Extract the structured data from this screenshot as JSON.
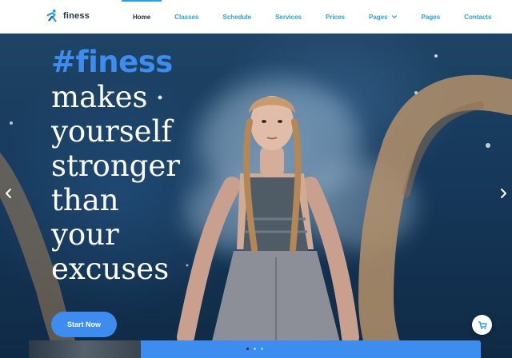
{
  "brand": {
    "name": "finess",
    "icon": "running-figure-icon",
    "color": "#2aa1dd"
  },
  "nav": {
    "items": [
      {
        "label": "Home",
        "active": true,
        "dropdown": false
      },
      {
        "label": "Classes",
        "active": false,
        "dropdown": false
      },
      {
        "label": "Schedule",
        "active": false,
        "dropdown": false
      },
      {
        "label": "Services",
        "active": false,
        "dropdown": false
      },
      {
        "label": "Prices",
        "active": false,
        "dropdown": false
      },
      {
        "label": "Pages",
        "active": false,
        "dropdown": true
      },
      {
        "label": "Pages",
        "active": false,
        "dropdown": false
      },
      {
        "label": "Contacts",
        "active": false,
        "dropdown": false
      }
    ]
  },
  "hero": {
    "hashtag": "#finess",
    "headline_lines": [
      "makes",
      "yourself",
      "stronger",
      "than",
      "your",
      "excuses"
    ],
    "cta_label": "Start Now",
    "prev_icon": "chevron-left-icon",
    "next_icon": "chevron-right-icon"
  },
  "slider": {
    "dot_count": 3,
    "active_dot": 0
  },
  "cart": {
    "icon": "shopping-cart-icon"
  },
  "colors": {
    "accent": "#3d8df0",
    "nav_link": "#2aa1dd",
    "nav_active": "#1d2b3a"
  }
}
